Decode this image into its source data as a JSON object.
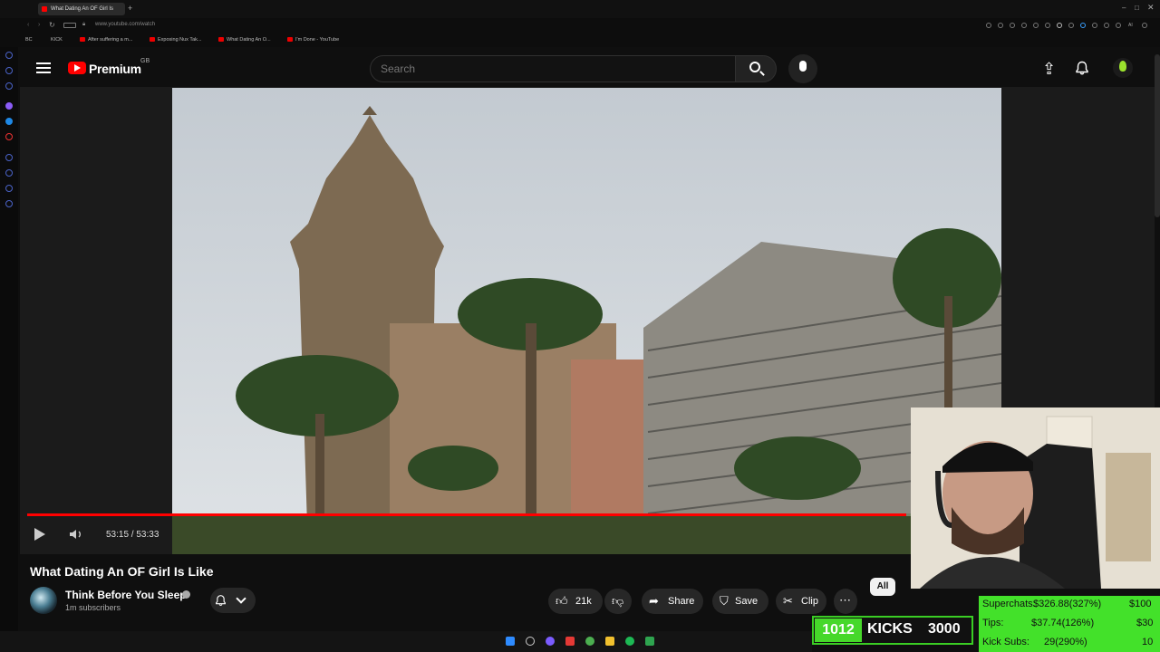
{
  "browser": {
    "active_tab_title": "What Dating An OF Girl Is",
    "url": "www.youtube.com/watch",
    "bookmarks": [
      "BC",
      "KICK",
      "After suffering a m...",
      "Exposing Nux Tak...",
      "What Dating An O...",
      "I'm Done - YouTube"
    ]
  },
  "header": {
    "logo_text": "Premium",
    "logo_region": "GB",
    "search_placeholder": "Search"
  },
  "player": {
    "time_current": "53:15",
    "time_total": "53:33",
    "timecode": "53:15 / 53:33",
    "progress": 0.9944
  },
  "video": {
    "title": "What Dating An OF Girl Is Like",
    "channel": "Think Before You Sleep",
    "subscribers": "1m subscribers",
    "likes": "21k",
    "share_label": "Share",
    "save_label": "Save",
    "clip_label": "Clip",
    "chip_all": "All"
  },
  "overlay": {
    "kicks_count": "1012",
    "kicks_label": "KICKS",
    "kicks_goal": "3000",
    "superchats_label": "Superchats:",
    "superchats_value": "$326.88(327%)",
    "superchats_goal": "$100",
    "tips_label": "Tips:",
    "tips_value": "$37.74(126%)",
    "tips_goal": "$30",
    "kick_subs_label": "Kick Subs:",
    "kick_subs_value": "29(290%)",
    "kick_subs_goal": "10"
  },
  "colors": {
    "brand_red": "#ff0000",
    "overlay_green": "#43e12a",
    "background": "#0f0f0f"
  }
}
